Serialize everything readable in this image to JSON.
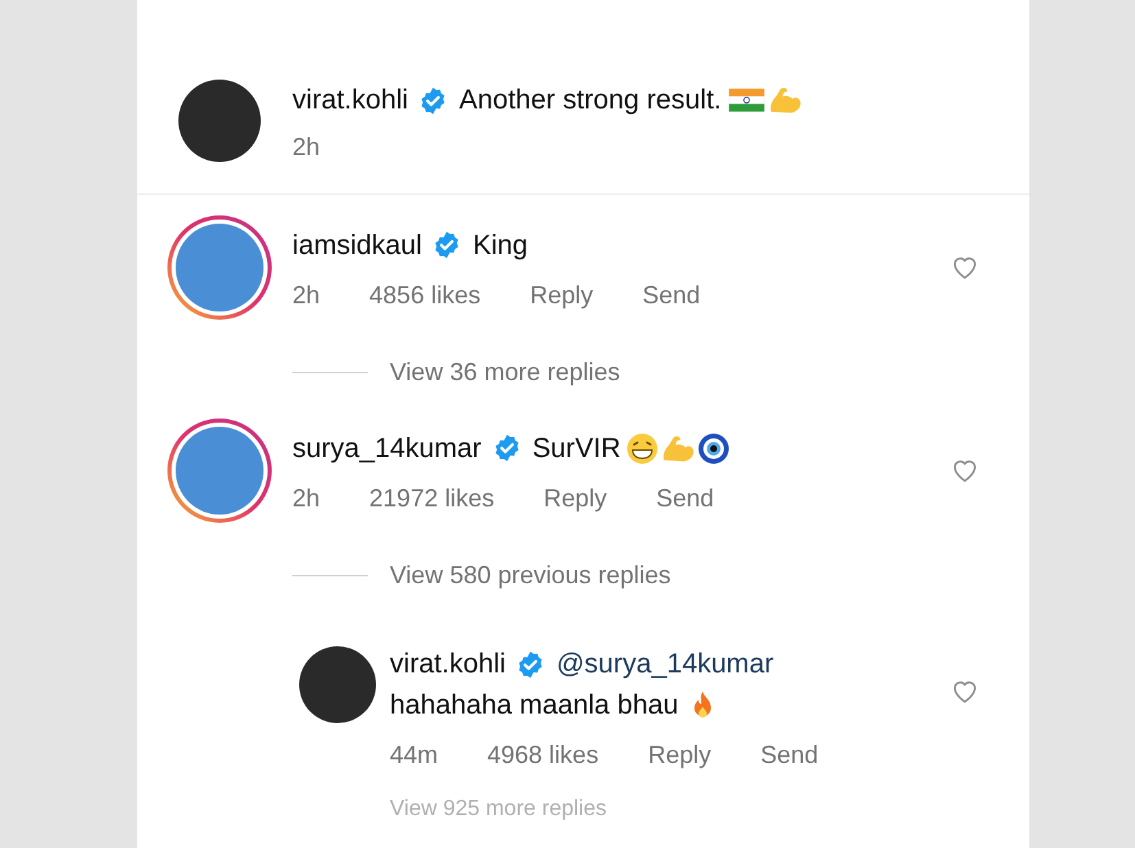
{
  "post_caption": {
    "username": "virat.kohli",
    "verified": true,
    "text": "Another strong result.",
    "emojis": [
      {
        "kind": "flag"
      },
      {
        "kind": "biceps"
      }
    ],
    "time": "2h",
    "story_ring": false
  },
  "comments": [
    {
      "username": "iamsidkaul",
      "verified": true,
      "text": "King",
      "time": "2h",
      "likes": "4856 likes",
      "reply": "Reply",
      "send": "Send",
      "story_ring": true,
      "liked": false,
      "replies_link": "View 36 more replies"
    },
    {
      "username": "surya_14kumar",
      "verified": true,
      "text": "SurVIR",
      "emojis": [
        {
          "kind": "grin"
        },
        {
          "kind": "biceps"
        },
        {
          "kind": "eye"
        }
      ],
      "time": "2h",
      "likes": "21972 likes",
      "reply": "Reply",
      "send": "Send",
      "story_ring": true,
      "liked": false,
      "replies_link": "View 580 previous replies",
      "replies": [
        {
          "username": "virat.kohli",
          "verified": true,
          "mention": "@surya_14kumar",
          "text": "hahahaha maanla bhau",
          "emojis": [
            {
              "kind": "fire"
            }
          ],
          "time": "44m",
          "likes": "4968 likes",
          "reply": "Reply",
          "send": "Send",
          "liked": false
        }
      ],
      "more_link": "View 925 more replies"
    }
  ]
}
